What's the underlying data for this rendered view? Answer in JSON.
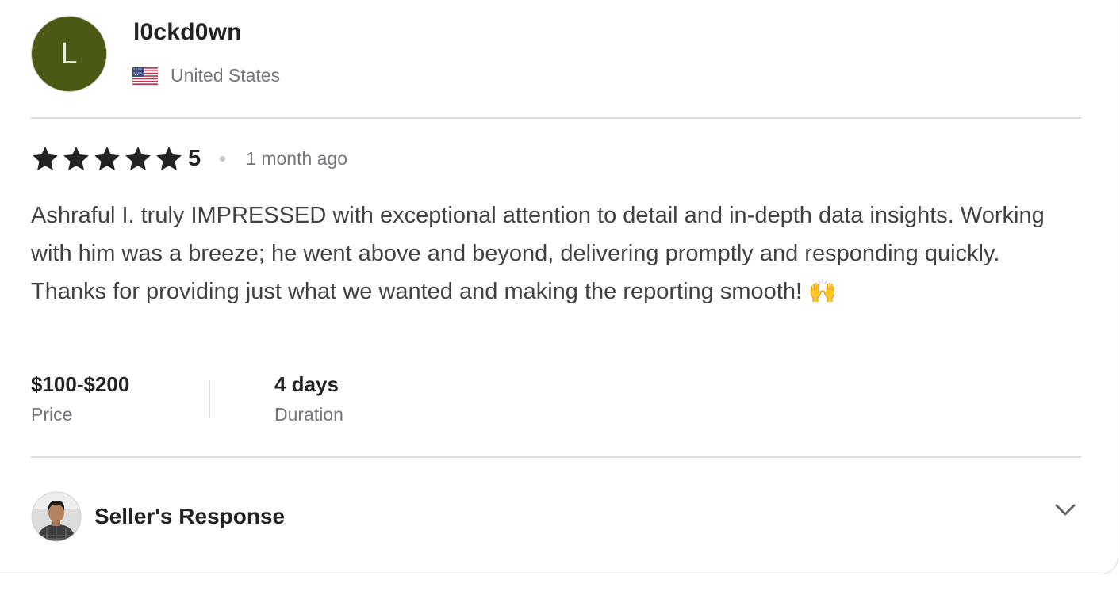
{
  "reviewer": {
    "avatar_initial": "L",
    "avatar_color": "#4a5a15",
    "username": "l0ckd0wn",
    "country_flag_icon": "us-flag-icon",
    "country": "United States"
  },
  "rating": {
    "stars": 5,
    "value": "5",
    "time_ago": "1 month ago"
  },
  "review_text": "Ashraful I. truly IMPRESSED with exceptional attention to detail and in-depth data insights. Working with him was a breeze; he went above and beyond, delivering promptly and responding quickly. Thanks for providing just what we wanted and making the reporting smooth! 🙌",
  "stats": {
    "price_value": "$100-$200",
    "price_label": "Price",
    "duration_value": "4 days",
    "duration_label": "Duration"
  },
  "seller_response": {
    "title": "Seller's Response",
    "toggle_icon": "chevron-down-icon"
  }
}
